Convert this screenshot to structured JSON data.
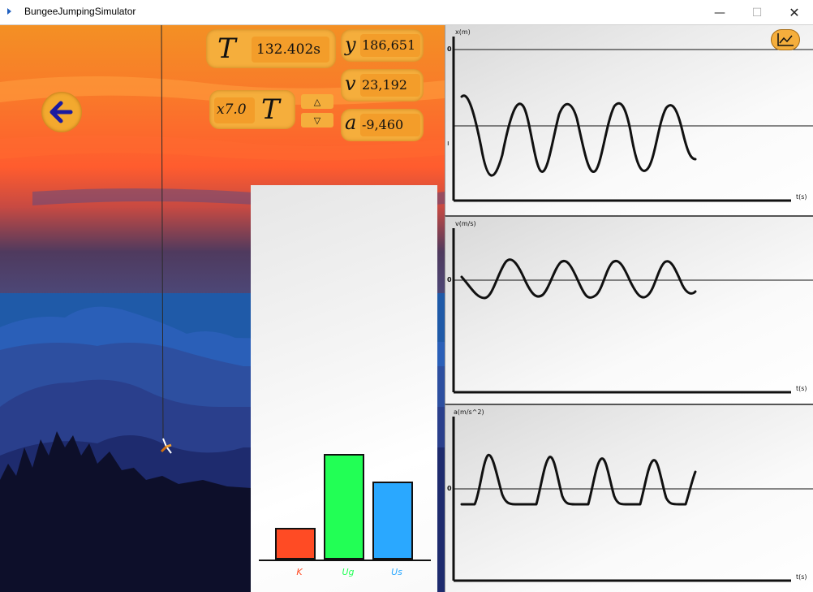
{
  "window": {
    "title": "BungeeJumpingSimulator",
    "minimize_glyph": "—",
    "maximize_glyph": "☐",
    "close_glyph": "✕"
  },
  "hud": {
    "time_symbol": "T",
    "time_value": "132.402s",
    "speed_prefix": "x7.0",
    "speed_symbol": "T",
    "step_up": "△",
    "step_down": "▽",
    "y_symbol": "y",
    "y_value": "186,651",
    "v_symbol": "v",
    "v_value": "23,192",
    "a_symbol": "a",
    "a_value": "-9,460"
  },
  "icons": {
    "back": "arrow-left-icon",
    "chart_toggle": "line-chart-icon",
    "jumper": "jumper-icon"
  },
  "energy": {
    "labels": [
      "K",
      "Ug",
      "Us"
    ],
    "values": [
      0.3,
      1.0,
      0.74
    ],
    "colors": [
      "#ff4b24",
      "#22ff55",
      "#2aa8ff"
    ]
  },
  "graphs": {
    "x": {
      "y_label": "x(m)",
      "x_label": "t(s)",
      "zero": "0"
    },
    "v": {
      "y_label": "v(m/s)",
      "x_label": "t(s)",
      "zero": "0"
    },
    "a": {
      "y_label": "a(m/s^2)",
      "x_label": "t(s)",
      "zero": "0"
    }
  },
  "colors": {
    "accent": "#f5ae3c",
    "back_arrow": "#1a1aa0"
  }
}
